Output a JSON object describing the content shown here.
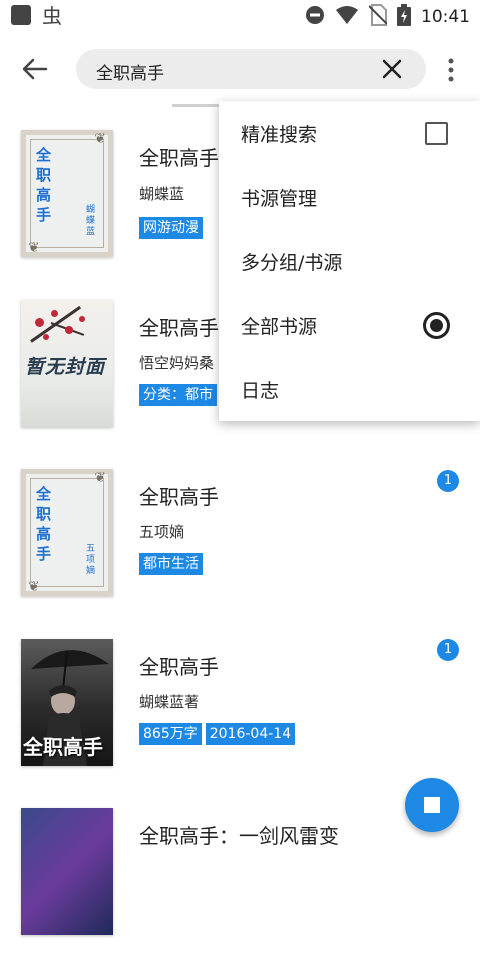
{
  "status_bar": {
    "time": "10:41",
    "icons": [
      "app-square-icon",
      "bug-icon",
      "dnd-icon",
      "wifi-icon",
      "no-sim-icon",
      "battery-charging-icon"
    ]
  },
  "search": {
    "query": "全职高手"
  },
  "menu": {
    "items": [
      {
        "label": "精准搜索",
        "control": "checkbox",
        "checked": false
      },
      {
        "label": "书源管理",
        "control": "none"
      },
      {
        "label": "多分组/书源",
        "control": "none"
      },
      {
        "label": "全部书源",
        "control": "radio",
        "selected": true
      },
      {
        "label": "日志",
        "control": "none"
      }
    ]
  },
  "books": [
    {
      "title": "全职高手",
      "author": "蝴蝶蓝",
      "tags": [
        "网游动漫"
      ],
      "cover_title": "全职高手",
      "cover_author": "蝴蝶蓝"
    },
    {
      "title": "全职高手",
      "author": "悟空妈妈桑",
      "tags": [
        "分类：都市"
      ],
      "cover_text": "暂无封面"
    },
    {
      "title": "全职高手",
      "author": "五项嫡",
      "tags": [
        "都市生活"
      ],
      "badge": "1",
      "cover_title": "全职高手",
      "cover_author": "五项嫡"
    },
    {
      "title": "全职高手",
      "author": "蝴蝶蓝著",
      "tags": [
        "865万字",
        "2016-04-14"
      ],
      "badge": "1",
      "cover_text": "全职高手"
    },
    {
      "title": "全职高手：一剑风雷变"
    }
  ],
  "colors": {
    "accent": "#1e88e5",
    "search_bg": "#ececec"
  }
}
